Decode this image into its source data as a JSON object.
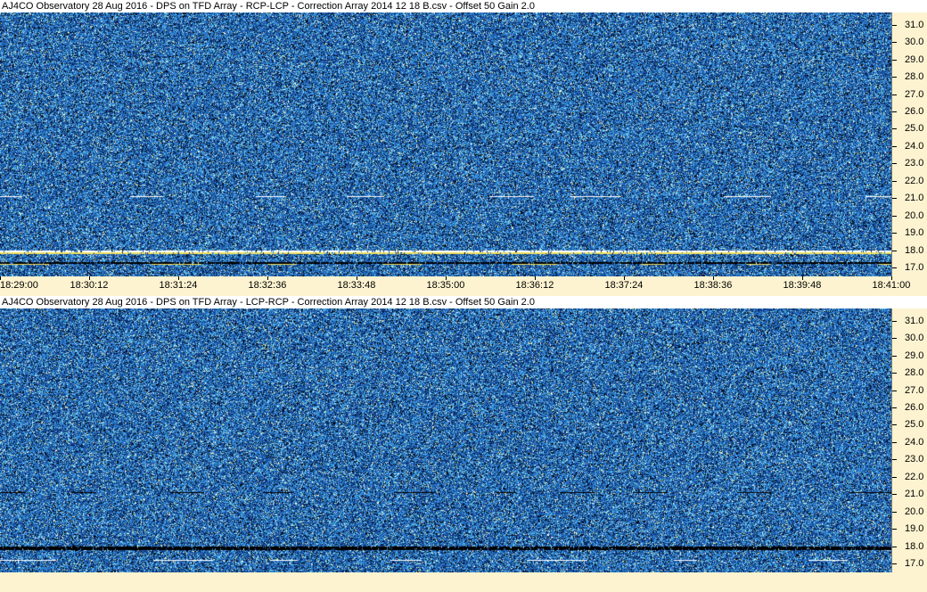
{
  "chart_data": [
    {
      "type": "heatmap",
      "title": "AJ4CO Observatory 28 Aug 2016  -  DPS on TFD Array  -  RCP-LCP  -  Correction Array 2014 12 18 B.csv  -  Offset 50  Gain 2.0",
      "x_tick_labels": [
        "18:29:00",
        "18:30:12",
        "18:31:24",
        "18:32:36",
        "18:33:48",
        "18:35:00",
        "18:36:12",
        "18:37:24",
        "18:38:36",
        "18:39:48",
        "18:41:00"
      ],
      "y_tick_labels": [
        "31.0",
        "30.0",
        "29.0",
        "28.0",
        "27.0",
        "26.0",
        "25.0",
        "24.0",
        "23.0",
        "22.0",
        "21.0",
        "20.0",
        "19.0",
        "18.0",
        "17.0"
      ],
      "ylim": [
        16.5,
        31.7
      ],
      "colormap": [
        "#000000",
        "#0a2a6e",
        "#1a4fa0",
        "#2f7fd0",
        "#40a8e8",
        "#7fd8e8",
        "#f0f0a0",
        "#ffffff"
      ],
      "features": [
        {
          "freq": 21.1,
          "color": "#ffffff",
          "style": "dashed"
        },
        {
          "freq": 18.0,
          "color": "#ffffff",
          "style": "solid"
        },
        {
          "freq": 17.9,
          "color": "#f0e060",
          "style": "solid"
        },
        {
          "freq": 17.3,
          "color": "#000000",
          "style": "solid"
        },
        {
          "freq": 17.2,
          "color": "#f0e060",
          "style": "dashed"
        }
      ]
    },
    {
      "type": "heatmap",
      "title": "AJ4CO Observatory 28 Aug 2016  -  DPS on TFD Array  -  LCP-RCP  -  Correction Array 2014 12 18 B.csv  -  Offset 50  Gain 2.0",
      "y_tick_labels": [
        "31.0",
        "30.0",
        "29.0",
        "28.0",
        "27.0",
        "26.0",
        "25.0",
        "24.0",
        "23.0",
        "22.0",
        "21.0",
        "20.0",
        "19.0",
        "18.0",
        "17.0"
      ],
      "ylim": [
        16.5,
        31.7
      ],
      "colormap": [
        "#000000",
        "#0a2a6e",
        "#1a4fa0",
        "#2f7fd0",
        "#40a8e8",
        "#7fd8e8",
        "#f0f0a0",
        "#ffffff"
      ],
      "features": [
        {
          "freq": 21.1,
          "color": "#000000",
          "style": "dashed"
        },
        {
          "freq": 18.0,
          "color": "#000000",
          "style": "solid"
        },
        {
          "freq": 17.9,
          "color": "#000000",
          "style": "solid"
        },
        {
          "freq": 17.2,
          "color": "#ffffff",
          "style": "dashed"
        }
      ]
    }
  ]
}
